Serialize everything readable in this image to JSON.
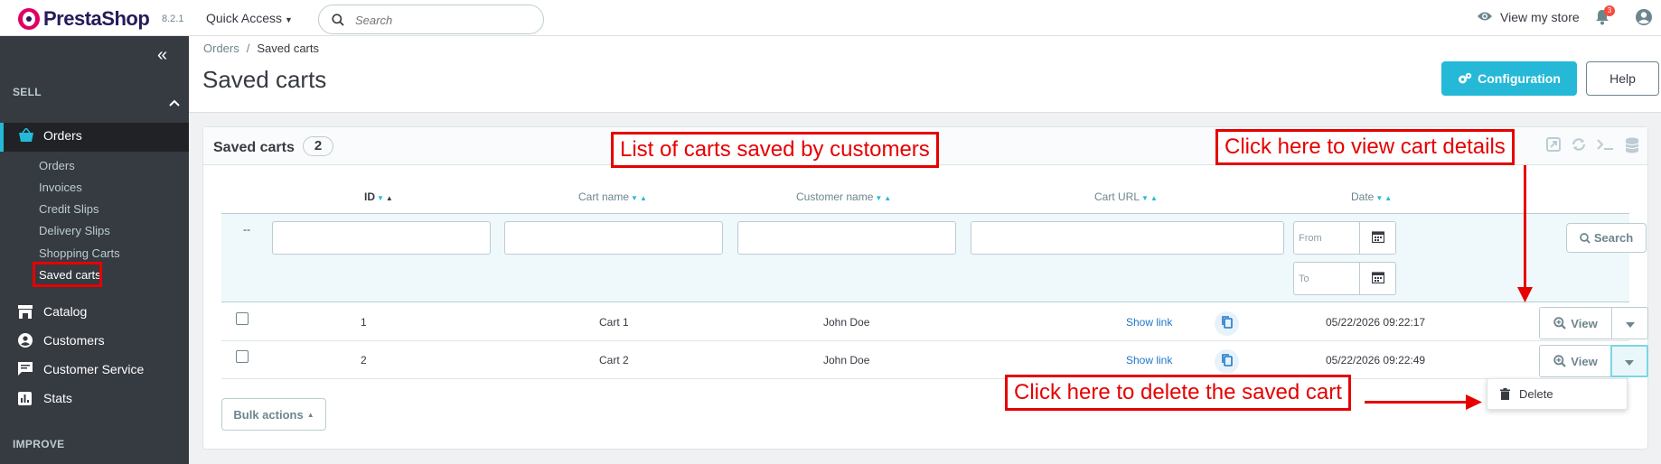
{
  "header": {
    "logo_text": "PrestaShop",
    "version": "8.2.1",
    "quick_access": "Quick Access",
    "search_placeholder": "Search",
    "view_store": "View my store",
    "notifications_count": "3"
  },
  "sidebar": {
    "sections": {
      "sell": "SELL",
      "improve": "IMPROVE"
    },
    "orders_label": "Orders",
    "orders_sub": [
      "Orders",
      "Invoices",
      "Credit Slips",
      "Delivery Slips",
      "Shopping Carts",
      "Saved carts"
    ],
    "items": [
      "Catalog",
      "Customers",
      "Customer Service",
      "Stats"
    ]
  },
  "toolbar": {
    "breadcrumb_parent": "Orders",
    "breadcrumb_sep": "/",
    "breadcrumb_current": "Saved carts",
    "title": "Saved carts",
    "configuration_label": "Configuration",
    "help_label": "Help"
  },
  "card": {
    "title": "Saved carts",
    "count": "2",
    "columns": [
      "ID",
      "Cart name",
      "Customer name",
      "Cart URL",
      "Date"
    ],
    "filter_dash": "--",
    "date_from_placeholder": "From",
    "date_to_placeholder": "To",
    "search_label": "Search",
    "rows": [
      {
        "id": "1",
        "cart_name": "Cart 1",
        "customer": "John Doe",
        "url_label": "Show link",
        "date": "05/22/2026 09:22:17",
        "view": "View"
      },
      {
        "id": "2",
        "cart_name": "Cart 2",
        "customer": "John Doe",
        "url_label": "Show link",
        "date": "05/22/2026 09:22:49",
        "view": "View"
      }
    ],
    "delete_label": "Delete",
    "bulk_actions": "Bulk actions"
  },
  "annotations": {
    "list": "List of carts saved by customers",
    "view": "Click here to view cart details",
    "delete": "Click here to delete the saved cart"
  },
  "colors": {
    "accent": "#25b9d7",
    "annotation": "#e60000",
    "sidebar": "#363a41",
    "brand": "#df0067"
  }
}
